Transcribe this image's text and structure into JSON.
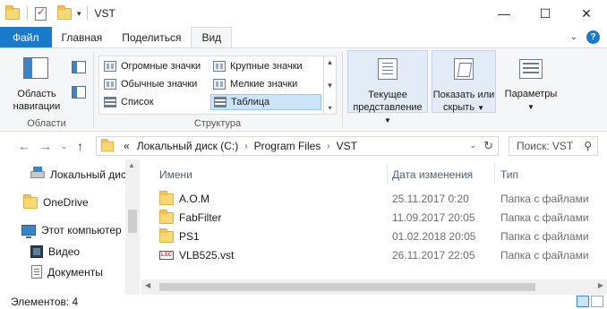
{
  "window": {
    "title": "VST",
    "controls": {
      "minimize": "—",
      "maximize": "☐",
      "close": "✕"
    }
  },
  "ribbon_tabs": {
    "file": "Файл",
    "home": "Главная",
    "share": "Поделиться",
    "view": "Вид"
  },
  "ribbon": {
    "panes": {
      "nav_pane_label": "Область навигации",
      "group_label": "Области"
    },
    "layout": {
      "items": [
        "Огромные значки",
        "Крупные значки",
        "Обычные значки",
        "Мелкие значки",
        "Список",
        "Таблица"
      ],
      "selected": "Таблица",
      "group_label": "Структура"
    },
    "current_view_label": "Текущее представление",
    "show_hide_label": "Показать или скрыть",
    "options_label": "Параметры"
  },
  "address": {
    "overflow": "«",
    "crumbs": [
      "Локальный диск (C:)",
      "Program Files",
      "VST"
    ],
    "search_placeholder": "Поиск: VST"
  },
  "nav_pane": {
    "items": [
      {
        "label": "Локальный диск",
        "icon": "drive-icon"
      },
      {
        "label": "OneDrive",
        "icon": "folder-icon"
      },
      {
        "label": "Этот компьютер",
        "icon": "computer-icon"
      },
      {
        "label": "Видео",
        "icon": "video-icon"
      },
      {
        "label": "Документы",
        "icon": "documents-icon"
      }
    ]
  },
  "columns": {
    "name": "Имени",
    "date": "Дата изменения",
    "type": "Тип"
  },
  "files": [
    {
      "name": "A.O.M",
      "date": "25.11.2017 0:20",
      "type": "Папка с файлами",
      "icon": "folder-icon"
    },
    {
      "name": "FabFilter",
      "date": "11.09.2017 20:05",
      "type": "Папка с файлами",
      "icon": "folder-icon"
    },
    {
      "name": "PS1",
      "date": "01.02.2018 20:05",
      "type": "Папка с файлами",
      "icon": "folder-icon"
    },
    {
      "name": "VLB525.vst",
      "date": "26.11.2017 22:05",
      "type": "Папка с файлами",
      "icon": "vst-icon"
    }
  ],
  "status": {
    "count": "Элементов: 4"
  },
  "colors": {
    "accent": "#1979ca",
    "selection": "#cce4f7"
  }
}
